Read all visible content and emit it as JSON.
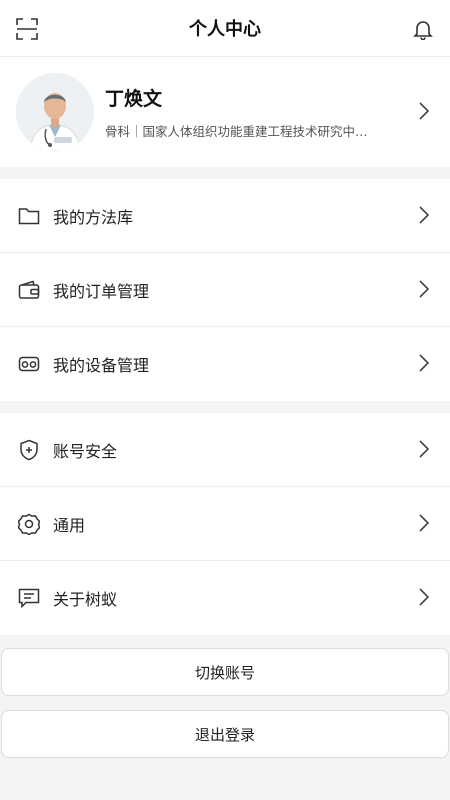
{
  "header": {
    "title": "个人中心",
    "left_icon": "scan-icon",
    "right_icon": "bell-icon"
  },
  "profile": {
    "name": "丁焕文",
    "subtitle": "骨科｜国家人体组织功能重建工程技术研究中…",
    "avatar_icon": "doctor-avatar"
  },
  "menu_group_1": [
    {
      "label": "我的方法库",
      "icon": "folder-icon"
    },
    {
      "label": "我的订单管理",
      "icon": "wallet-icon"
    },
    {
      "label": "我的设备管理",
      "icon": "vr-headset-icon"
    }
  ],
  "menu_group_2": [
    {
      "label": "账号安全",
      "icon": "shield-icon"
    },
    {
      "label": "通用",
      "icon": "gear-icon"
    },
    {
      "label": "关于树蚁",
      "icon": "message-icon"
    }
  ],
  "buttons": {
    "switch_account": "切换账号",
    "logout": "退出登录"
  }
}
